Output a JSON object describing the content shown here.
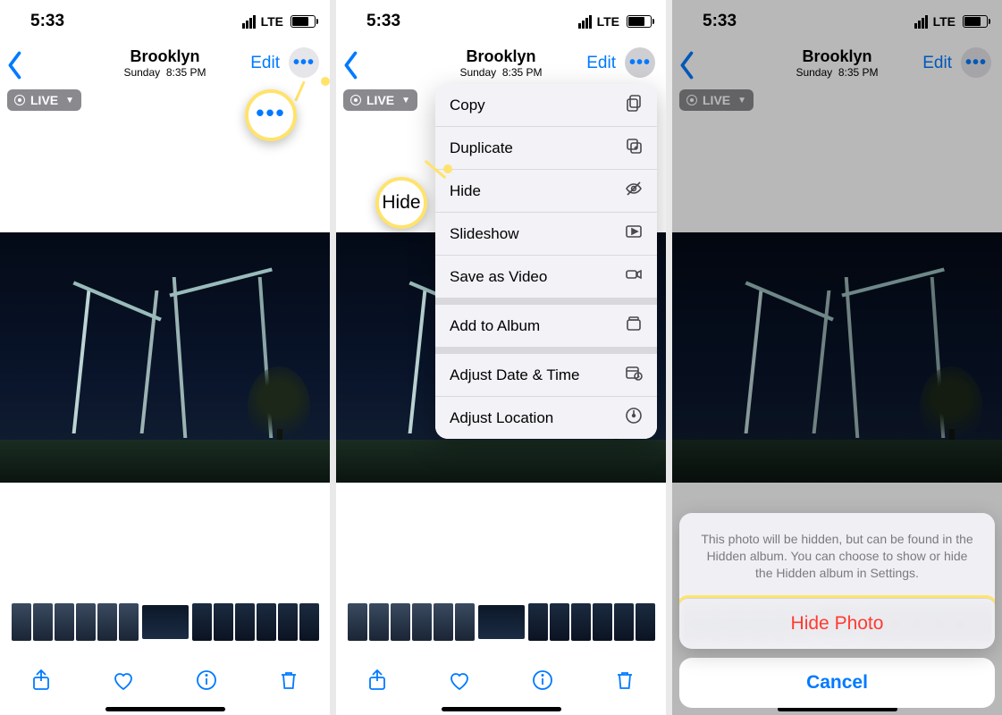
{
  "status": {
    "time": "5:33",
    "carrier": "LTE"
  },
  "nav": {
    "title": "Brooklyn",
    "subtitle_day": "Sunday",
    "subtitle_time": "8:35 PM",
    "edit_label": "Edit"
  },
  "live_badge": "LIVE",
  "callouts": {
    "more_label": "•••",
    "hide_label": "Hide"
  },
  "menu": {
    "items1": [
      "Copy",
      "Duplicate",
      "Hide",
      "Slideshow",
      "Save as Video"
    ],
    "items2": [
      "Add to Album"
    ],
    "items3": [
      "Adjust Date & Time",
      "Adjust Location"
    ]
  },
  "sheet": {
    "message": "This photo will be hidden, but can be found in the Hidden album. You can choose to show or hide the Hidden album in Settings.",
    "action": "Hide Photo",
    "cancel": "Cancel"
  },
  "icons": {
    "copy": "copy-icon",
    "duplicate": "duplicate-icon",
    "hide": "eye-slash-icon",
    "slideshow": "play-rect-icon",
    "save_video": "video-icon",
    "add_album": "album-add-icon",
    "adjust_date": "calendar-clock-icon",
    "adjust_location": "location-icon"
  }
}
